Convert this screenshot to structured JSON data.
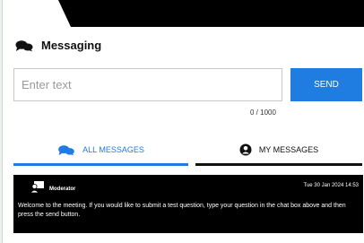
{
  "header": {
    "title": "Messaging",
    "icon": "chat-bubbles-icon"
  },
  "composer": {
    "placeholder": "Enter text",
    "value": "",
    "send_label": "SEND",
    "counter": "0 / 1000"
  },
  "tabs": [
    {
      "label": "ALL MESSAGES",
      "icon": "chat-bubbles-icon",
      "active": true
    },
    {
      "label": "MY MESSAGES",
      "icon": "user-icon",
      "active": false
    }
  ],
  "messages": [
    {
      "sender": "Moderator",
      "timestamp": "Tue 30 Jan 2024 14:53",
      "text": "Welcome to the meeting. If you would like to submit a test question, type your question in the chat box above and then press the send button.",
      "avatar_icon": "moderator-icon"
    }
  ],
  "colors": {
    "accent": "#1f7ce0",
    "message_background": "#000000",
    "page_background": "#e8f1ea"
  }
}
